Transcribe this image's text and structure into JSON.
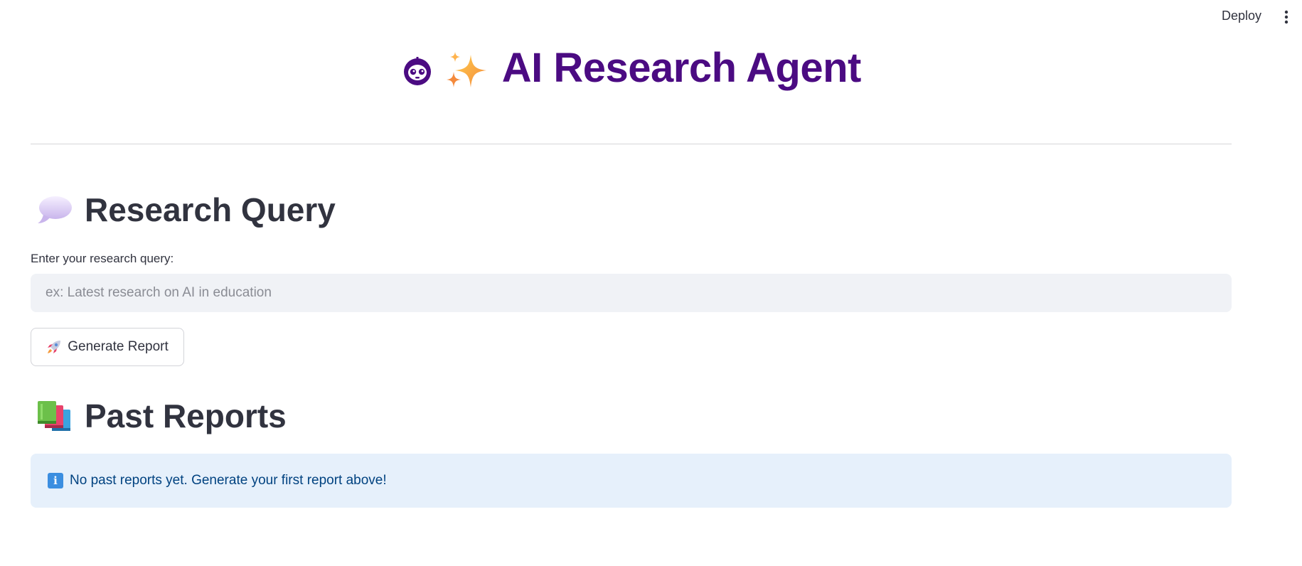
{
  "header": {
    "deploy_label": "Deploy",
    "menu_icon": "vertical-ellipsis-icon"
  },
  "app": {
    "title": "AI Research Agent",
    "title_icons": [
      "robot-face-icon",
      "sparkles-icon"
    ],
    "title_color": "#4b0b82"
  },
  "query_section": {
    "heading": "Research Query",
    "heading_icon": "speech-bubble-icon",
    "input_label": "Enter your research query:",
    "input_value": "",
    "input_placeholder": "ex: Latest research on AI in education",
    "button_label": "Generate Report",
    "button_icon": "rocket-icon"
  },
  "reports_section": {
    "heading": "Past Reports",
    "heading_icon": "books-icon",
    "info_message": "No past reports yet. Generate your first report above!",
    "info_icon": "info-icon",
    "info_glyph": "i"
  },
  "colors": {
    "text": "#31333f",
    "info_bg": "#e6f0fb",
    "info_text": "#004280",
    "input_bg": "#f0f2f6"
  }
}
